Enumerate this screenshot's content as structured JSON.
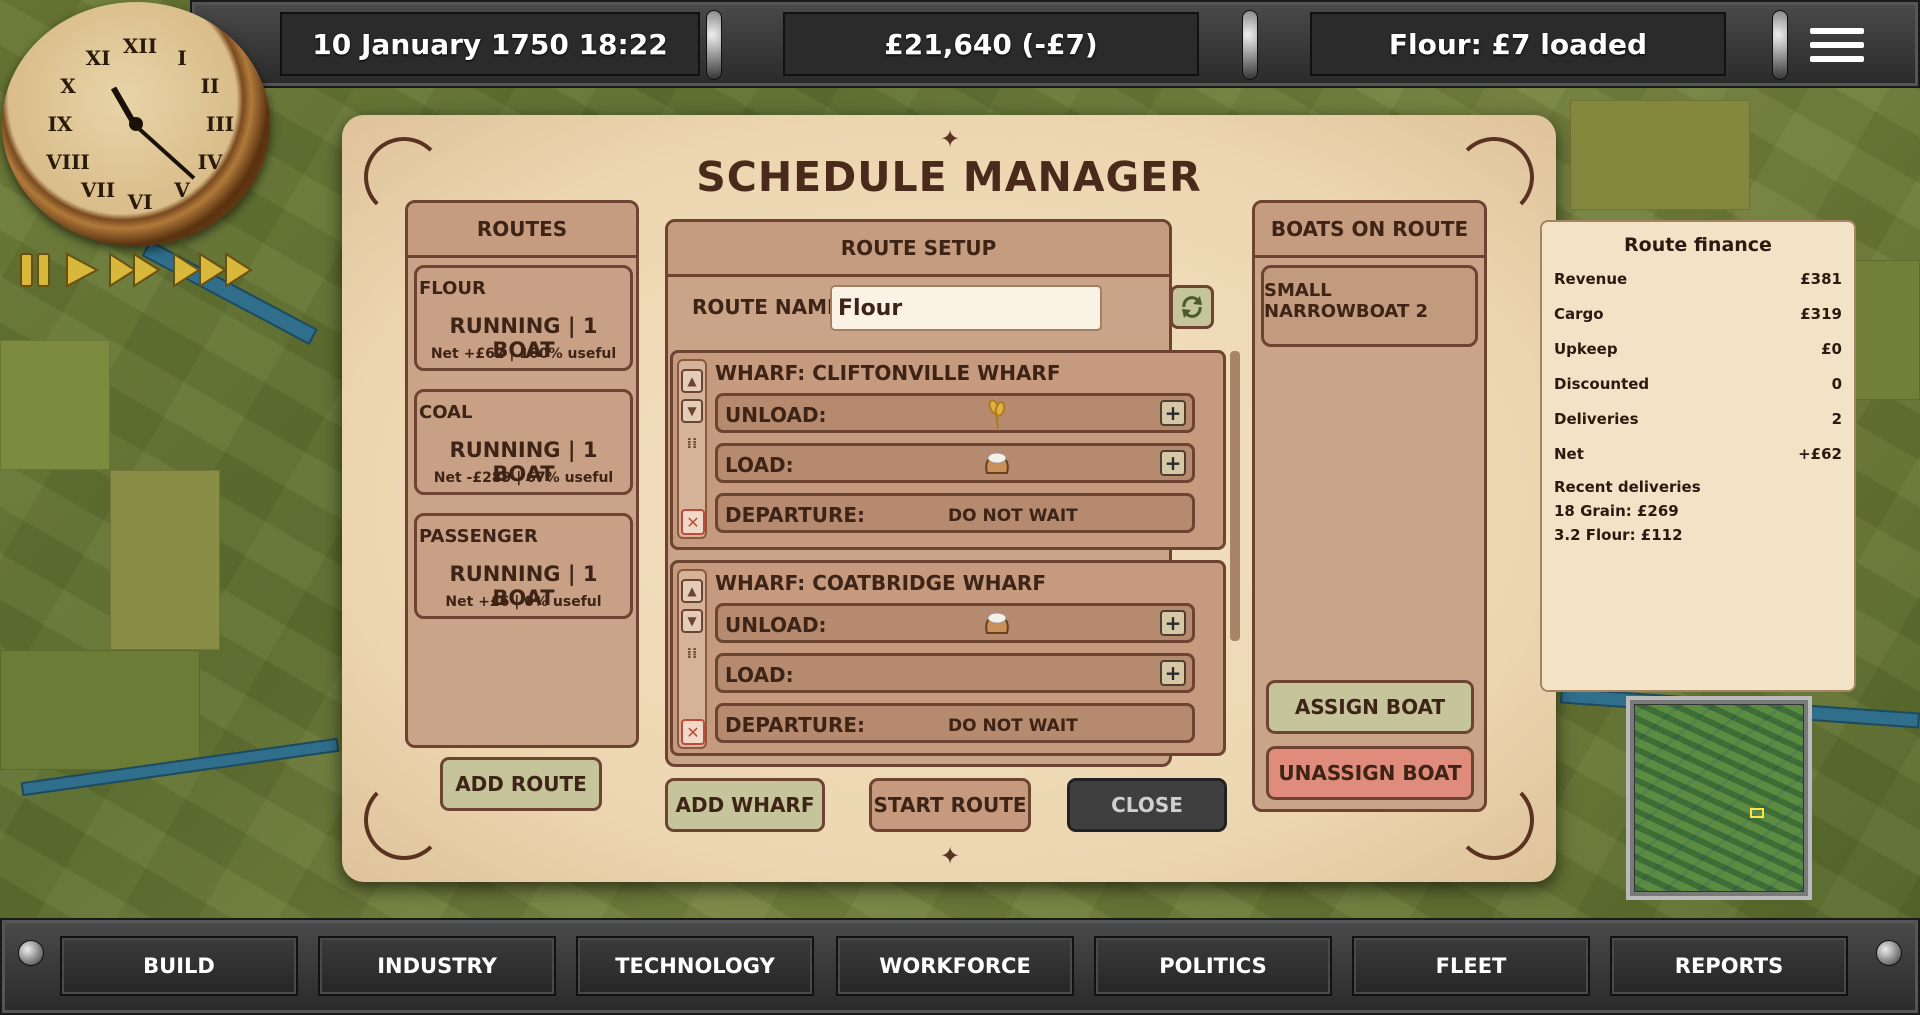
{
  "topbar": {
    "datetime": "10 January 1750  18:22",
    "money": "£21,640 (-£7)",
    "status": "Flour: £7 loaded"
  },
  "menu_icon": "hamburger-menu-icon",
  "speed_controls": [
    "pause-icon",
    "play-icon",
    "fast-forward-icon",
    "fastest-forward-icon"
  ],
  "dialog": {
    "title": "SCHEDULE MANAGER",
    "routes": {
      "header": "ROUTES",
      "items": [
        {
          "name": "FLOUR",
          "status": "RUNNING | 1 BOAT",
          "summary": "Net +£62 | 100% useful"
        },
        {
          "name": "COAL",
          "status": "RUNNING | 1 BOAT",
          "summary": "Net -£289 | 67% useful"
        },
        {
          "name": "PASSENGER",
          "status": "RUNNING | 1 BOAT",
          "summary": "Net +£6 | 0% useful"
        }
      ],
      "add_label": "ADD ROUTE"
    },
    "setup": {
      "header": "ROUTE SETUP",
      "name_label": "ROUTE NAME:",
      "name_value": "Flour",
      "wharves": [
        {
          "title": "WHARF: CLIFTONVILLE WHARF",
          "unload_label": "UNLOAD:",
          "unload_icon": "grain-icon",
          "load_label": "LOAD:",
          "load_icon": "flour-sack-icon",
          "departure_label": "DEPARTURE:",
          "departure_value": "DO NOT WAIT"
        },
        {
          "title": "WHARF: COATBRIDGE WHARF",
          "unload_label": "UNLOAD:",
          "unload_icon": "flour-sack-icon",
          "load_label": "LOAD:",
          "load_icon": "",
          "departure_label": "DEPARTURE:",
          "departure_value": "DO NOT WAIT"
        }
      ],
      "add_wharf_label": "ADD WHARF",
      "start_label": "START ROUTE",
      "close_label": "CLOSE"
    },
    "boats": {
      "header": "BOATS ON ROUTE",
      "items": [
        "SMALL NARROWBOAT 2"
      ],
      "assign_label": "ASSIGN BOAT",
      "unassign_label": "UNASSIGN BOAT"
    }
  },
  "finance": {
    "title": "Route finance",
    "rows": [
      {
        "label": "Revenue",
        "value": "£381"
      },
      {
        "label": "Cargo",
        "value": "£319"
      },
      {
        "label": "Upkeep",
        "value": "£0"
      },
      {
        "label": "Discounted",
        "value": "0"
      },
      {
        "label": "Deliveries",
        "value": "2"
      },
      {
        "label": "Net",
        "value": "+£62"
      }
    ],
    "recent_title": "Recent deliveries",
    "recent": [
      "18 Grain: £269",
      "3.2 Flour: £112"
    ]
  },
  "bottom_nav": [
    "BUILD",
    "INDUSTRY",
    "TECHNOLOGY",
    "WORKFORCE",
    "POLITICS",
    "FLEET",
    "REPORTS"
  ],
  "colors": {
    "accent": "#6d4432",
    "parchment": "#ecd6b0",
    "assign": "#c6c49a",
    "unassign": "#e08c7c",
    "close": "#3f3f3f"
  }
}
